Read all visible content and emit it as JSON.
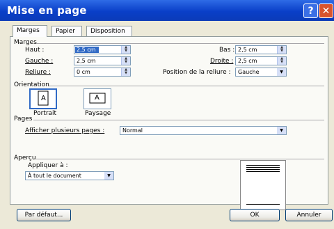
{
  "window": {
    "title": "Mise en page",
    "help_icon": "?",
    "close_icon": "✕"
  },
  "tabs": [
    {
      "label": "Marges",
      "selected": true
    },
    {
      "label": "Papier",
      "selected": false
    },
    {
      "label": "Disposition",
      "selected": false
    }
  ],
  "marges": {
    "group_label": "Marges",
    "haut": {
      "label": "Haut :",
      "value": "2,5 cm"
    },
    "bas": {
      "label": "Bas :",
      "value": "2,5 cm"
    },
    "gauche": {
      "label": "Gauche :",
      "value": "2,5 cm"
    },
    "droite": {
      "label": "Droite :",
      "value": "2,5 cm"
    },
    "reliure": {
      "label": "Reliure :",
      "value": "0 cm"
    },
    "position_reliure": {
      "label": "Position de la reliure :",
      "value": "Gauche"
    }
  },
  "orientation": {
    "group_label": "Orientation",
    "portrait": {
      "label": "Portrait",
      "glyph": "A"
    },
    "paysage": {
      "label": "Paysage",
      "glyph": "A"
    }
  },
  "pages": {
    "group_label": "Pages",
    "afficher_label": "Afficher plusieurs pages :",
    "afficher_value": "Normal"
  },
  "apercu": {
    "group_label": "Aperçu",
    "appliquer_label": "Appliquer à :",
    "appliquer_value": "À tout le document"
  },
  "buttons": {
    "par_defaut": "Par défaut...",
    "ok": "OK",
    "annuler": "Annuler"
  },
  "colors": {
    "titlebar": "#0A3FC8",
    "selection": "#316AC5",
    "close": "#D8542E"
  }
}
